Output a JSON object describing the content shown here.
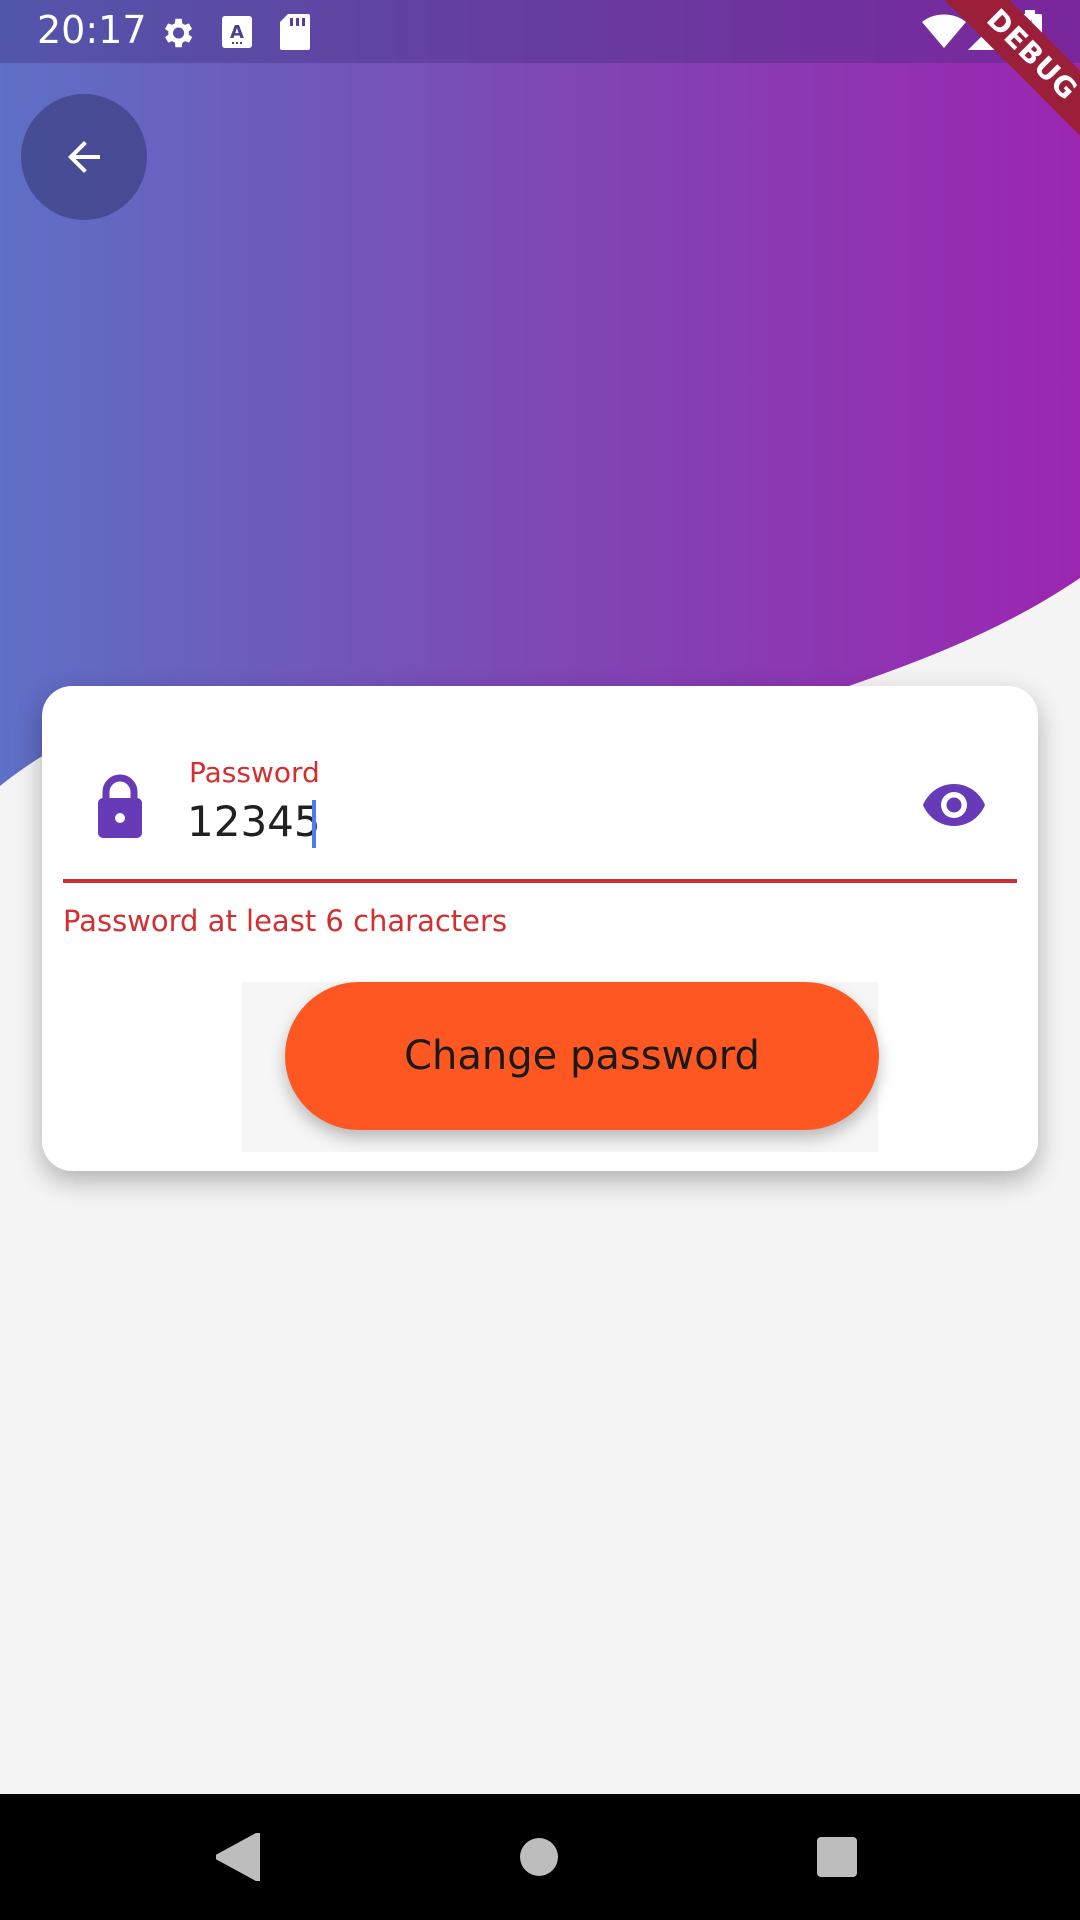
{
  "status_bar": {
    "time": "20:17",
    "debug_label": "DEBUG"
  },
  "header": {
    "back_label": "Back"
  },
  "form": {
    "password_label": "Password",
    "password_value": "12345",
    "error_text": "Password at least 6 characters",
    "submit_label": "Change password"
  },
  "colors": {
    "gradient_start": "#5e6fc6",
    "gradient_end": "#9b26b0",
    "error": "#d32f2f",
    "accent": "#673ab7",
    "button": "#ff5722"
  },
  "icons": {
    "status": [
      "settings-icon",
      "a11y-text-icon",
      "sd-card-icon",
      "wifi-icon",
      "signal-icon",
      "battery-charging-icon"
    ],
    "field_prefix": "lock-icon",
    "field_suffix": "eye-icon",
    "nav": [
      "back-triangle-icon",
      "home-circle-icon",
      "recents-square-icon"
    ]
  }
}
